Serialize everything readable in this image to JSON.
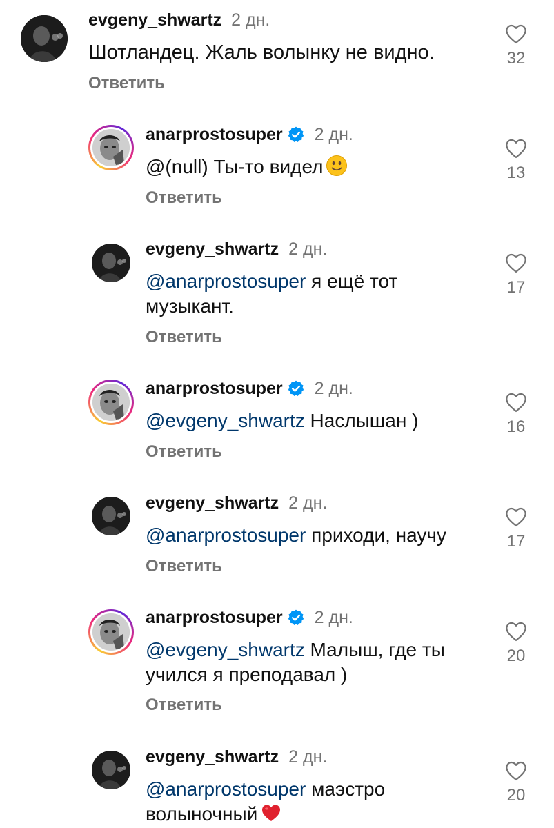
{
  "reply_label": "Ответить",
  "comments": [
    {
      "username": "evgeny_shwartz",
      "time": "2 дн.",
      "mention": "",
      "text": "Шотландец. Жаль волынку не видно.",
      "likes": "32",
      "verified": false
    },
    {
      "username": "anarprostosuper",
      "time": "2 дн.",
      "mention": "",
      "text": "@(null) Ты-то видел",
      "emoji": "slightly-smiling-face-emoji",
      "likes": "13",
      "verified": true
    },
    {
      "username": "evgeny_shwartz",
      "time": "2 дн.",
      "mention": "@anarprostosuper",
      "text": " я ещё тот музыкант.",
      "likes": "17",
      "verified": false
    },
    {
      "username": "anarprostosuper",
      "time": "2 дн.",
      "mention": "@evgeny_shwartz",
      "text": " Наслышан )",
      "likes": "16",
      "verified": true
    },
    {
      "username": "evgeny_shwartz",
      "time": "2 дн.",
      "mention": "@anarprostosuper",
      "text": " приходи, научу",
      "likes": "17",
      "verified": false
    },
    {
      "username": "anarprostosuper",
      "time": "2 дн.",
      "mention": "@evgeny_shwartz",
      "text": " Малыш, где ты учился я преподавал )",
      "likes": "20",
      "verified": true
    },
    {
      "username": "evgeny_shwartz",
      "time": "2 дн.",
      "mention": "@anarprostosuper",
      "text": " маэстро волыночный",
      "emoji": "red-heart-emoji",
      "likes": "20",
      "verified": false
    }
  ],
  "colors": {
    "mention": "#00376b",
    "muted": "#737373",
    "verified": "#0095f6",
    "heart": "#e0212e"
  }
}
